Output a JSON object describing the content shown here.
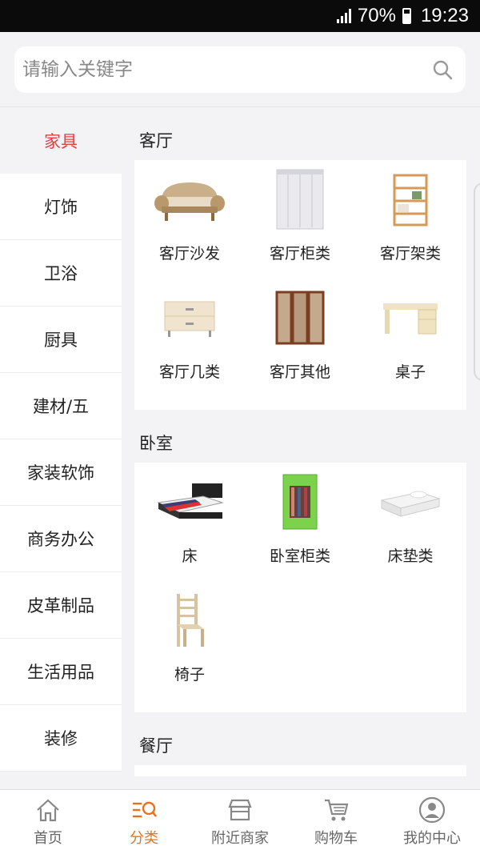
{
  "status": {
    "battery": "70%",
    "time": "19:23"
  },
  "search": {
    "placeholder": "请输入关键字"
  },
  "sidebar": {
    "items": [
      {
        "label": "家具",
        "active": true
      },
      {
        "label": "灯饰"
      },
      {
        "label": "卫浴"
      },
      {
        "label": "厨具"
      },
      {
        "label": "建材/五"
      },
      {
        "label": "家装软饰"
      },
      {
        "label": "商务办公"
      },
      {
        "label": "皮革制品"
      },
      {
        "label": "生活用品"
      },
      {
        "label": "装修"
      }
    ]
  },
  "sections": [
    {
      "title": "客厅",
      "items": [
        {
          "label": "客厅沙发",
          "icon": "sofa-icon"
        },
        {
          "label": "客厅柜类",
          "icon": "wardrobe-icon"
        },
        {
          "label": "客厅架类",
          "icon": "shelf-icon"
        },
        {
          "label": "客厅几类",
          "icon": "side-table-icon"
        },
        {
          "label": "客厅其他",
          "icon": "folding-screen-icon"
        },
        {
          "label": "桌子",
          "icon": "desk-icon"
        }
      ]
    },
    {
      "title": "卧室",
      "items": [
        {
          "label": "床",
          "icon": "bed-icon"
        },
        {
          "label": "卧室柜类",
          "icon": "cloth-wardrobe-icon"
        },
        {
          "label": "床垫类",
          "icon": "mattress-icon"
        },
        {
          "label": "椅子",
          "icon": "chair-icon"
        }
      ]
    },
    {
      "title": "餐厅",
      "items": [
        {
          "icon": "study-desk-icon"
        },
        {
          "icon": "storage-box-icon"
        },
        {
          "icon": "dining-table-icon"
        }
      ]
    }
  ],
  "tabbar": {
    "items": [
      {
        "label": "首页",
        "icon": "home-icon"
      },
      {
        "label": "分类",
        "icon": "category-search-icon",
        "active": true
      },
      {
        "label": "附近商家",
        "icon": "store-icon"
      },
      {
        "label": "购物车",
        "icon": "cart-icon"
      },
      {
        "label": "我的中心",
        "icon": "user-icon"
      }
    ]
  },
  "colors": {
    "active_side": "#e04040",
    "active_tab": "#e8711c",
    "background": "#f3f3f5"
  }
}
